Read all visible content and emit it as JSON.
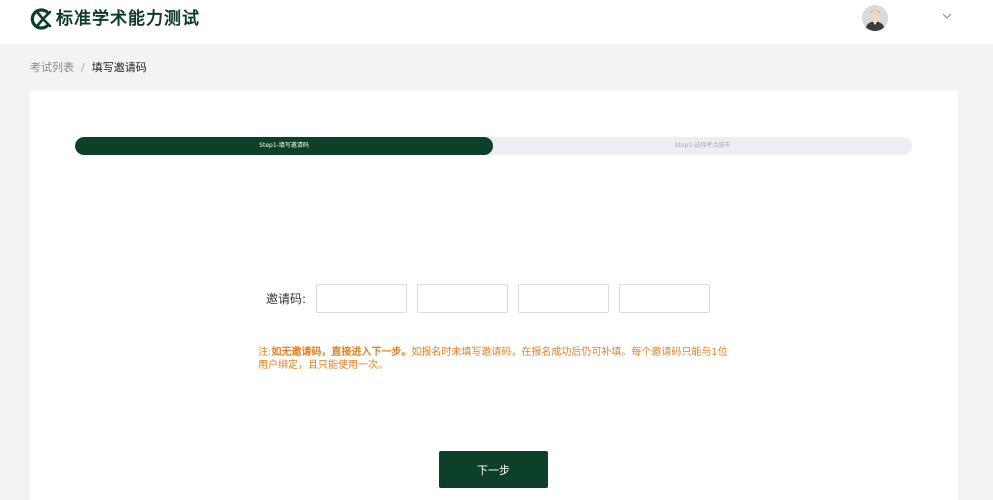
{
  "header": {
    "brand": "标准学术能力测试",
    "avatar_icon": "user-avatar-icon",
    "menu_icon": "chevron-down-icon"
  },
  "breadcrumb": {
    "parent": "考试列表",
    "separator": "/",
    "current": "填写邀请码"
  },
  "steps": [
    {
      "label": "Step1-填写邀请码",
      "active": true
    },
    {
      "label": "Step2-选择考点城市",
      "active": false
    }
  ],
  "form": {
    "code_label": "邀请码:",
    "code_fields": [
      {
        "value": ""
      },
      {
        "value": ""
      },
      {
        "value": ""
      },
      {
        "value": ""
      }
    ]
  },
  "note": {
    "prefix": "注:",
    "emphasis": "如无邀请码，直接进入下一步。",
    "body": "如报名时未填写邀请码，在报名成功后仍可补填。每个邀请码只能与1位用户绑定，且只能使用一次。"
  },
  "next_button": {
    "label": "下一步"
  },
  "colors": {
    "brand": "#0c4029",
    "note": "#e4801f",
    "step_inactive": "#edeef3"
  }
}
